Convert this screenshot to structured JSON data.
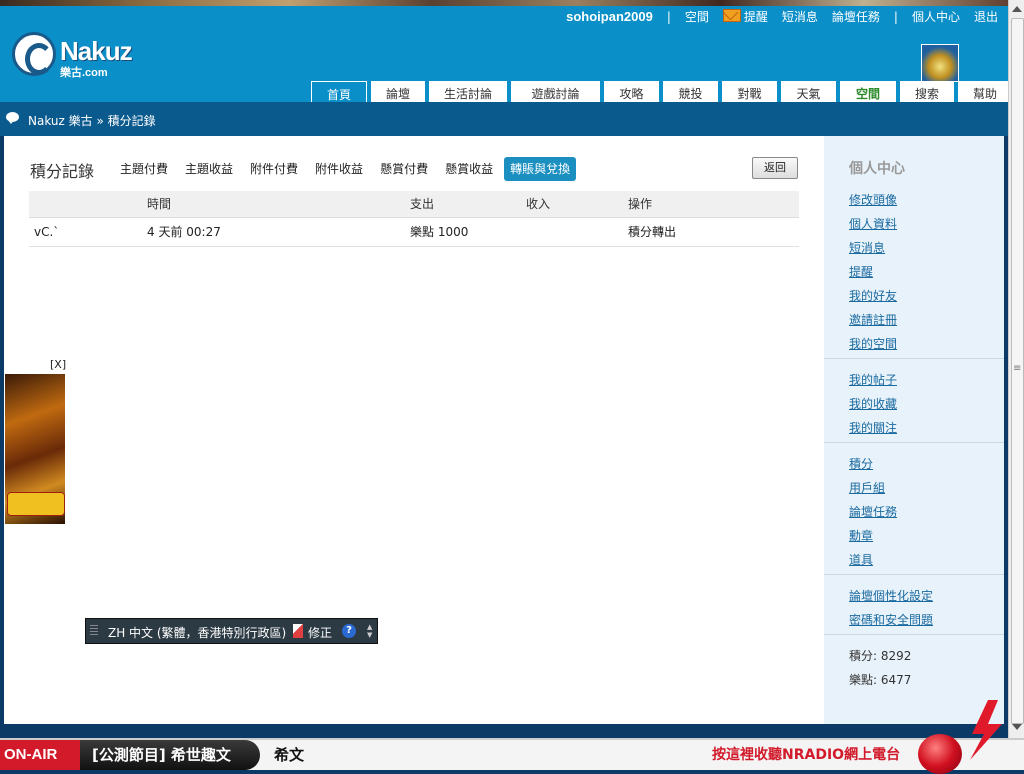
{
  "brand": {
    "logo_text": "Nakuz",
    "logo_sub": "樂古.com"
  },
  "topnav": {
    "user": "sohoipan2009",
    "sep1": "|",
    "space": "空間",
    "remind": "提醒",
    "messages": "短消息",
    "forum_tasks": "論壇任務",
    "sep2": "|",
    "personal_center": "個人中心",
    "logout": "退出"
  },
  "tabs": [
    "首頁",
    "論壇",
    "生活討論",
    "遊戲討論",
    "攻略",
    "競投",
    "對戰",
    "天氣",
    "空間",
    "搜索",
    "幫助"
  ],
  "breadcrumb": "Nakuz 樂古 » 積分記錄",
  "page": {
    "title": "積分記錄",
    "subtabs": [
      "主題付費",
      "主題收益",
      "附件付費",
      "附件收益",
      "懸賞付費",
      "懸賞收益",
      "轉賬與兌換"
    ],
    "back_label": "返回"
  },
  "table": {
    "headers": [
      "",
      "時間",
      "支出",
      "收入",
      "操作"
    ],
    "rows": [
      [
        "vC.`",
        "4 天前 00:27",
        "樂點 1000",
        "",
        "積分轉出"
      ]
    ]
  },
  "sidebar": {
    "heading": "個人中心",
    "group1": [
      "修改頭像",
      "個人資料",
      "短消息",
      "提醒",
      "我的好友",
      "邀請註冊",
      "我的空間"
    ],
    "group2": [
      "我的帖子",
      "我的收藏",
      "我的關注"
    ],
    "group3": [
      "積分",
      "用戶組",
      "論壇任務",
      "勳章",
      "道具"
    ],
    "group4": [
      "論壇個性化設定",
      "密碼和安全問題"
    ],
    "stats": [
      "積分: 8292",
      "樂點: 6477"
    ]
  },
  "ad": {
    "close_label": "[X]"
  },
  "ime": {
    "language": "ZH 中文 (繁體，香港特別行政區)",
    "fix_label": "修正",
    "help": "?"
  },
  "footer": {
    "onair": "ON-AIR",
    "program": "[公測節目] 希世趣文",
    "song": "希文",
    "listen": "按這裡收聽NRADIO網上電台"
  },
  "colors": {
    "header": "#0a8fc8",
    "breadcrumb": "#0b5a8e",
    "active_subtab": "#1a8fc0",
    "link": "#1a6aa0",
    "onair": "#d21a2a"
  }
}
